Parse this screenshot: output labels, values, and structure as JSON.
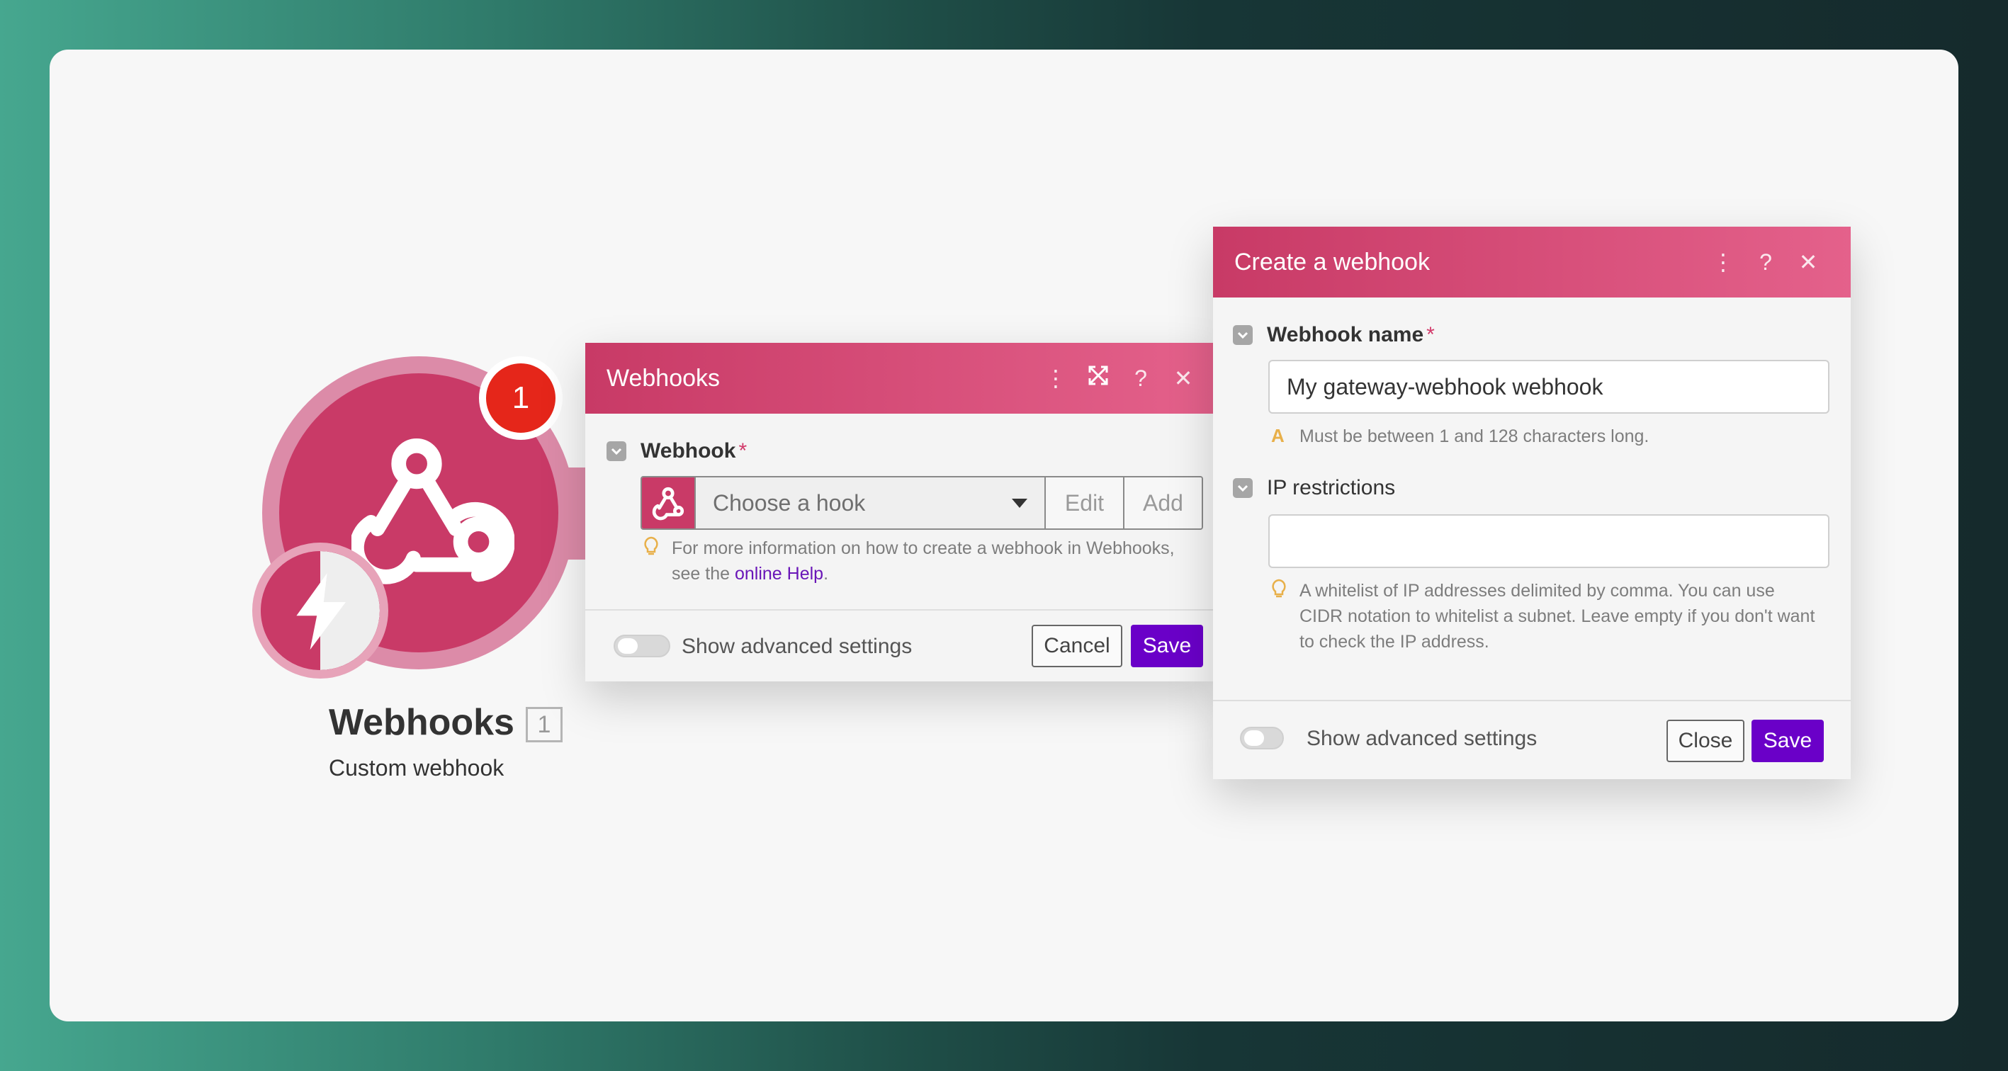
{
  "module": {
    "title": "Webhooks",
    "id": "1",
    "subtitle": "Custom webhook",
    "badge_count": "1",
    "icon": "webhook-icon",
    "trigger_icon": "lightning-bolt-icon"
  },
  "webhooks_dialog": {
    "title": "Webhooks",
    "header_icons": [
      "more-vertical-icon",
      "expand-icon",
      "help-icon",
      "close-icon"
    ],
    "field_label": "Webhook",
    "required_mark": "*",
    "select_placeholder": "Choose a hook",
    "edit_label": "Edit",
    "add_label": "Add",
    "hint_text_1": "For more information on how to create a webhook in Webhooks,",
    "hint_text_2": "see the",
    "hint_link": "online Help",
    "hint_end": ".",
    "advanced_label": "Show advanced settings",
    "cancel_label": "Cancel",
    "save_label": "Save"
  },
  "create_dialog": {
    "title": "Create a webhook",
    "header_icons": [
      "more-vertical-icon",
      "help-icon",
      "close-icon"
    ],
    "name_label": "Webhook name",
    "required_mark": "*",
    "name_value": "My gateway-webhook webhook",
    "name_hint": "Must be between 1 and 128 characters long.",
    "ip_label": "IP restrictions",
    "ip_value": "",
    "ip_hint_1": "A whitelist of IP addresses delimited by comma. You can use",
    "ip_hint_2": "CIDR notation to whitelist a subnet. Leave empty if you don't want",
    "ip_hint_3": "to check the IP address.",
    "advanced_label": "Show advanced settings",
    "close_label": "Close",
    "save_label": "Save"
  },
  "colors": {
    "brand_pink": "#c93a67",
    "primary_purple": "#6a00c8",
    "badge_red": "#e5261a",
    "link_purple": "#6a16b8"
  }
}
